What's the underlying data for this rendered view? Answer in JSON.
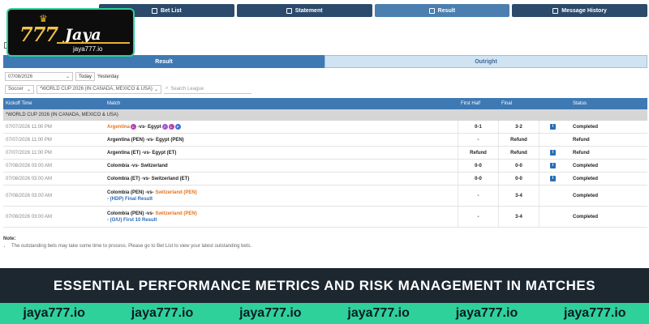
{
  "nav": [
    {
      "label": "Bet List",
      "icon": "list-icon",
      "active": false
    },
    {
      "label": "Statement",
      "icon": "document-icon",
      "active": false
    },
    {
      "label": "Result",
      "icon": "calculator-icon",
      "active": true
    },
    {
      "label": "Message History",
      "icon": "envelope-icon",
      "active": false
    }
  ],
  "logo": {
    "number": "777",
    "name": "Jaya",
    "domain": "jaya777.io"
  },
  "tabs": [
    {
      "label": "Result",
      "active": true
    },
    {
      "label": "Outright",
      "active": false
    }
  ],
  "filters": {
    "date_value": "07/08/2026",
    "today_label": "Today",
    "yesterday_label": "Yesterday",
    "sport_value": "Soccer",
    "league_value": "*WORLD CUP 2026 (IN CANADA, MEXICO & USA)",
    "search_placeholder": "Search League"
  },
  "table": {
    "headers": {
      "kickoff": "Kickoff Time",
      "match": "Match",
      "first_half": "First Half",
      "final": "Final",
      "status": "Status"
    },
    "group_label": "*WORLD CUP 2026 (IN CANADA, MEXICO & USA)",
    "rows": [
      {
        "kickoff": "07/07/2026 11:00 PM",
        "team_a": "Argentina",
        "vs": " -vs- ",
        "team_b": "Egypt",
        "first_half": "0-1",
        "final": "3-2",
        "status": "Completed"
      },
      {
        "kickoff": "07/07/2026 11:00 PM",
        "match": "Argentina (PEN) -vs- Egypt (PEN)",
        "first_half": "-",
        "final": "Refund",
        "status": "Refund"
      },
      {
        "kickoff": "07/07/2026 11:00 PM",
        "match": "Argentina (ET) -vs- Egypt (ET)",
        "first_half": "Refund",
        "final": "Refund",
        "status": "Refund"
      },
      {
        "kickoff": "07/08/2026 03:00 AM",
        "match": "Colombia -vs- Switzerland",
        "first_half": "0-0",
        "final": "0-0",
        "status": "Completed"
      },
      {
        "kickoff": "07/08/2026 03:00 AM",
        "match": "Colombia (ET) -vs- Switzerland (ET)",
        "first_half": "0-0",
        "final": "0-0",
        "status": "Completed"
      },
      {
        "kickoff": "07/08/2026 03:00 AM",
        "team_a": "Colombia (PEN)",
        "vs": " -vs- ",
        "team_b": "Switzerland (PEN)",
        "sub": "- (HDP) Final Result",
        "first_half": "-",
        "final": "3-4",
        "status": "Completed"
      },
      {
        "kickoff": "07/08/2026 03:00 AM",
        "team_a": "Colombia (PEN)",
        "vs": " -vs- ",
        "team_b": "Switzerland (PEN)",
        "sub": "- (O/U) First 10 Result",
        "first_half": "-",
        "final": "3-4",
        "status": "Completed"
      }
    ]
  },
  "note": {
    "title": "Note:",
    "text": "The outstanding bets may take some time to process. Please go to Bet List to view your latest outstanding bets."
  },
  "banner": {
    "text": "ESSENTIAL PERFORMANCE METRICS AND RISK MANAGEMENT IN MATCHES"
  },
  "strip": [
    "jaya777.io",
    "jaya777.io",
    "jaya777.io",
    "jaya777.io",
    "jaya777.io",
    "jaya777.io"
  ],
  "colors": {
    "nav": "#2c4a6b",
    "accent": "#3e79b4",
    "brand_green": "#2fd19b",
    "banner_bg": "#1c2730",
    "highlight_team": "#e8731a"
  }
}
